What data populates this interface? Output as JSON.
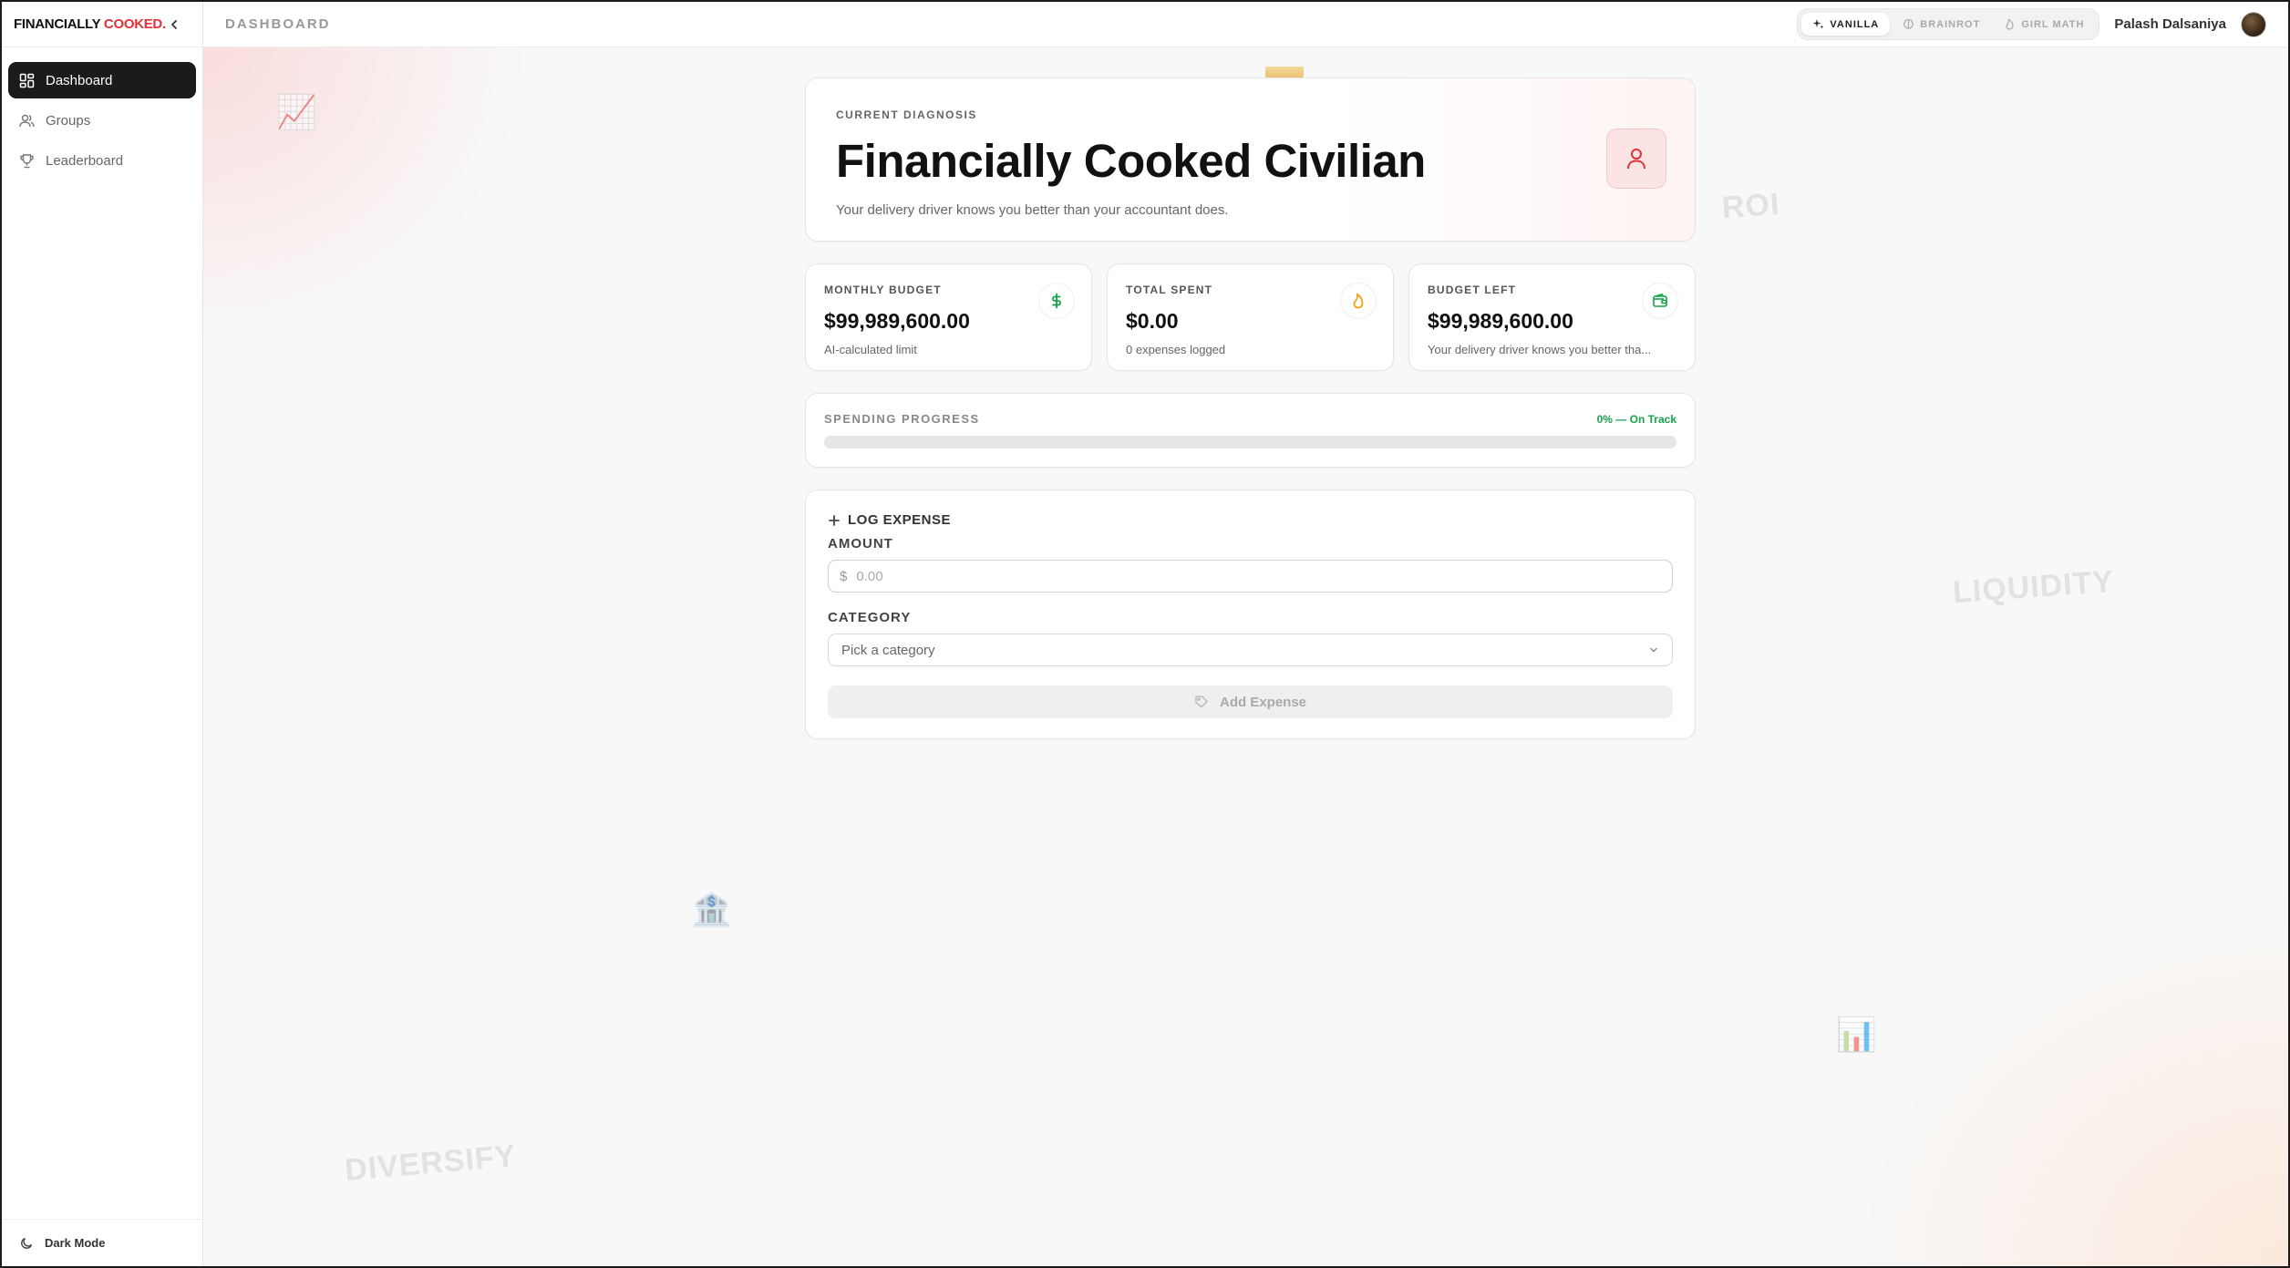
{
  "brand": {
    "part1": "FINANCIALLY ",
    "part2": "COOKED."
  },
  "sidebar": {
    "items": [
      {
        "label": "Dashboard",
        "icon": "dashboard-icon",
        "active": true
      },
      {
        "label": "Groups",
        "icon": "users-icon",
        "active": false
      },
      {
        "label": "Leaderboard",
        "icon": "trophy-icon",
        "active": false
      }
    ],
    "footer_label": "Dark Mode"
  },
  "topbar": {
    "title": "DASHBOARD",
    "modes": [
      {
        "label": "VANILLA",
        "icon": "sparkle-icon",
        "active": true
      },
      {
        "label": "BRAINROT",
        "icon": "brain-icon",
        "active": false
      },
      {
        "label": "GIRL MATH",
        "icon": "flame-icon",
        "active": false
      }
    ],
    "user_name": "Palash Dalsaniya"
  },
  "decor": {
    "words": [
      "ROI",
      "LIQUIDITY",
      "DIVERSIFY"
    ],
    "emojis": [
      "📈",
      "🏦",
      "📊"
    ]
  },
  "diagnosis": {
    "label": "CURRENT DIAGNOSIS",
    "title": "Financially Cooked Civilian",
    "subtitle": "Your delivery driver knows you better than your accountant does."
  },
  "stats": [
    {
      "label": "MONTHLY BUDGET",
      "value": "$99,989,600.00",
      "sub": "AI-calculated limit",
      "icon": "dollar-icon",
      "color": "#16a34a"
    },
    {
      "label": "TOTAL SPENT",
      "value": "$0.00",
      "sub": "0 expenses logged",
      "icon": "flame-icon",
      "color": "#f59e0b"
    },
    {
      "label": "BUDGET LEFT",
      "value": "$99,989,600.00",
      "sub": "Your delivery driver knows you better tha...",
      "icon": "wallet-icon",
      "color": "#16a34a"
    }
  ],
  "progress": {
    "label": "SPENDING PROGRESS",
    "status": "0% — On Track",
    "percent": 0,
    "color": "#16a34a"
  },
  "expense": {
    "heading": "LOG EXPENSE",
    "amount_label": "AMOUNT",
    "currency_symbol": "$",
    "amount_placeholder": "0.00",
    "category_label": "CATEGORY",
    "category_placeholder": "Pick a category",
    "submit_label": "Add Expense"
  },
  "colors": {
    "accent": "#e0323a",
    "success": "#16a34a",
    "warning": "#f59e0b"
  }
}
